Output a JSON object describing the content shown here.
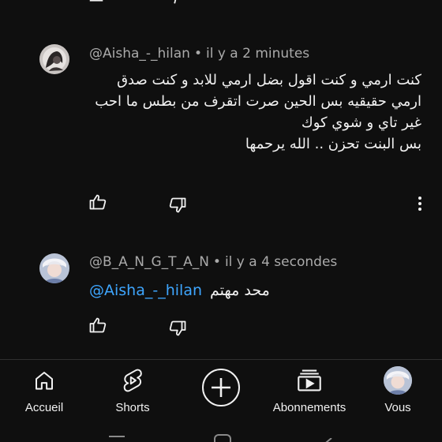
{
  "comments": [
    {
      "author": "@Aisha_-_hilan",
      "separator": "•",
      "time": "il y a 2 minutes",
      "lines": [
        "كنت ارمي و كنت اقول بضل ارمي للابد و كنت صدق",
        "ارمي حقيقيه بس الحين صرت اتقرف من بطس ما احب",
        "غير تاي و شوي كوك",
        "بس البنت تحزن .. الله يرحمها"
      ]
    },
    {
      "author": "@B_A_N_G_T_A_N",
      "separator": "•",
      "time": "il y a 4 secondes",
      "mention": "@Aisha_-_hilan",
      "text": "محد مهتم"
    }
  ],
  "icons": {
    "like": "thumb-up-icon",
    "dislike": "thumb-down-icon",
    "more": "more-vertical-icon"
  },
  "bottom_nav": {
    "home": "Accueil",
    "shorts": "Shorts",
    "subscriptions": "Abonnements",
    "you": "Vous"
  },
  "colors": {
    "background": "#0f0f0f",
    "text": "#f1f1f1",
    "secondary_text": "#aaaaaa",
    "mention": "#3ea6ff"
  }
}
